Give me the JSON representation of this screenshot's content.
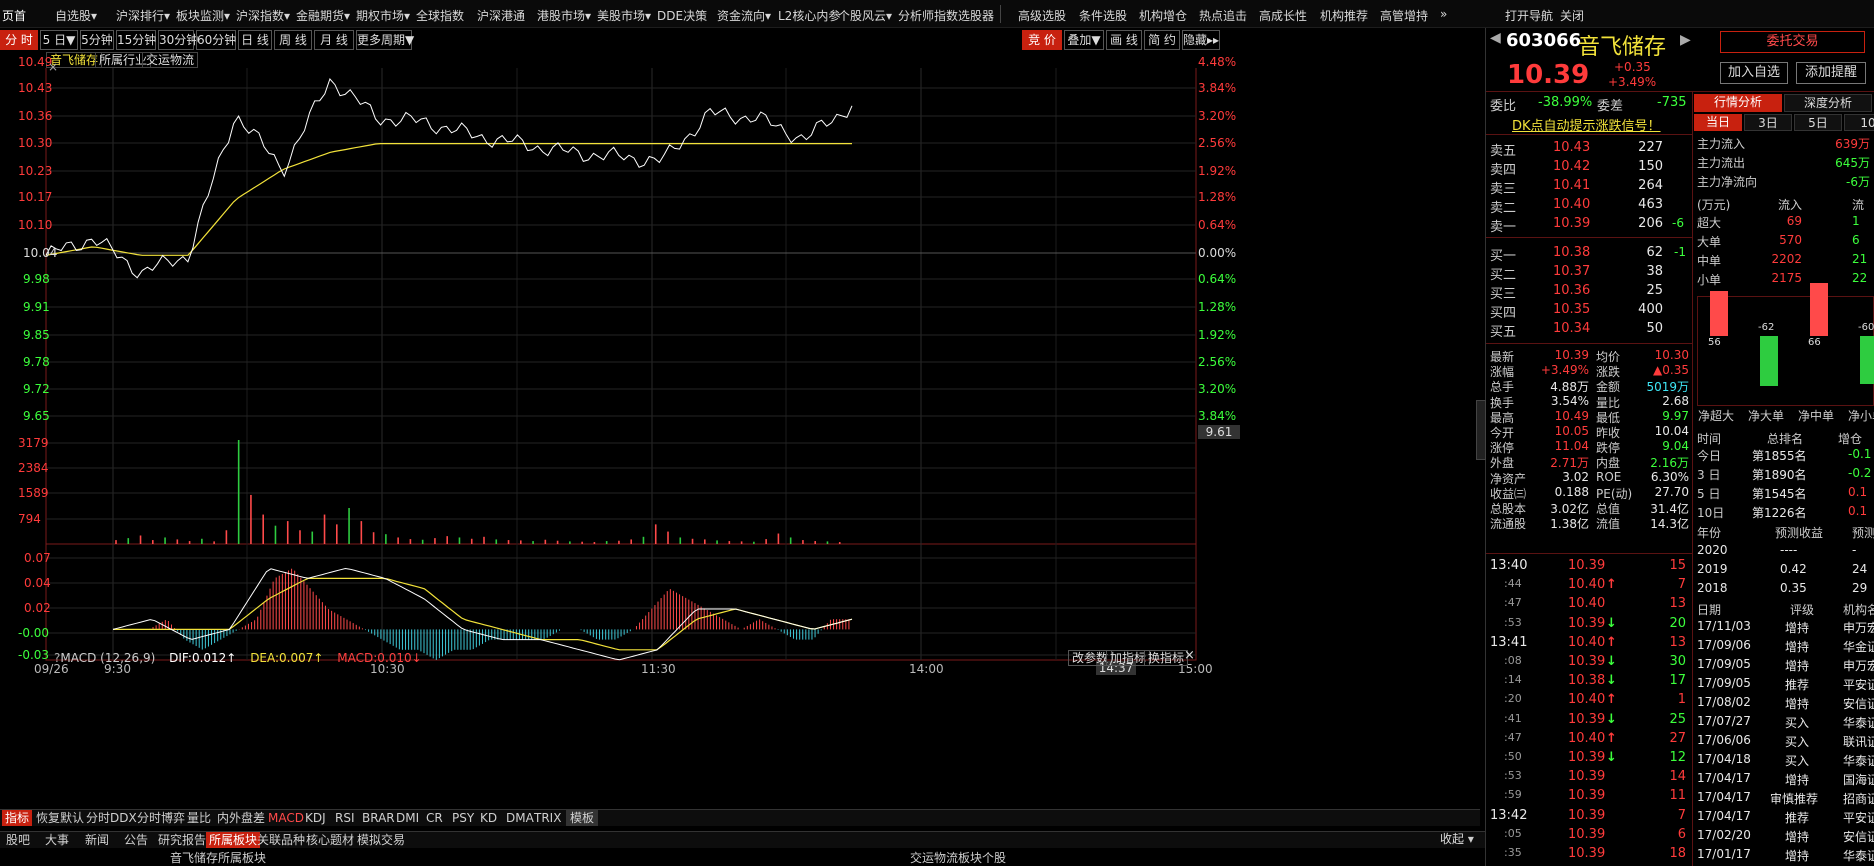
{
  "top_menu": [
    "页首",
    "自选股▾",
    "沪深排行▾",
    "板块监测▾",
    "沪深指数▾",
    "金融期货▾",
    "期权市场▾",
    "全球指数",
    "沪深港通",
    "港股市场▾",
    "美股市场▾",
    "DDE决策",
    "资金流向▾",
    "L2核心内参",
    "个股风云▾",
    "分析师指数",
    "选股器",
    "高级选股",
    "条件选股",
    "机构增仓",
    "热点追击",
    "高成长性",
    "机构推荐",
    "高管增持",
    "»",
    "打开导航",
    "关闭"
  ],
  "period_buttons": [
    "分 时",
    "5 日▼",
    "5分钟",
    "15分钟",
    "30分钟",
    "60分钟",
    "日 线",
    "周 线",
    "月 线",
    "更多周期▼"
  ],
  "chart_tools": [
    "竞 价",
    "叠加▼",
    "画 线",
    "简 约",
    "隐藏▸▸"
  ],
  "sub_tabs": [
    "音飞储存",
    "所属行业",
    "交运物流"
  ],
  "stock": {
    "code": "603066",
    "name": "音飞储存",
    "price": "10.39",
    "change": "+0.35",
    "change_pct": "+3.49%",
    "trade_button": "委托交易",
    "add_watch": "加入自选",
    "add_alert": "添加提醒"
  },
  "price_axis_left": [
    "10.49",
    "10.43",
    "10.36",
    "10.30",
    "10.23",
    "10.17",
    "10.10",
    "10.04",
    "9.98",
    "9.91",
    "9.85",
    "9.78",
    "9.72",
    "9.65"
  ],
  "pct_axis_right": [
    "4.48%",
    "3.84%",
    "3.20%",
    "2.56%",
    "1.92%",
    "1.28%",
    "0.64%",
    "0.00%",
    "0.64%",
    "1.28%",
    "1.92%",
    "2.56%",
    "3.20%",
    "3.84%"
  ],
  "cursor_price": "9.61",
  "volume_axis": [
    "3179",
    "2384",
    "1589",
    "794"
  ],
  "macd": {
    "title": "MACD (12,26,9)",
    "dif": "DIF:0.012↑",
    "dea": "DEA:0.007↑",
    "macd": "MACD:0.010↓",
    "buttons": [
      "改参数",
      "加指标",
      "换指标"
    ],
    "axis": [
      "0.07",
      "0.04",
      "0.02",
      "-0.00",
      "-0.03"
    ]
  },
  "time_axis": [
    "09/26",
    "9:30",
    "10:30",
    "11:30",
    "14:00",
    "15:00"
  ],
  "cursor_time": "14:37",
  "indicator_tabs": [
    "指标",
    "恢复默认",
    "分时DDX",
    "分时博弈",
    "量比",
    "内外盘差",
    "MACD",
    "KDJ",
    "RSI",
    "BRAR",
    "DMI",
    "CR",
    "PSY",
    "KD",
    "DMA",
    "TRIX",
    "模板"
  ],
  "bottom_tabs": [
    "股吧",
    "大事",
    "新闻",
    "公告",
    "研究报告",
    "所属板块",
    "关联品种",
    "核心题材",
    "模拟交易"
  ],
  "bottom_collapse": "收起",
  "bottom_titles": [
    "音飞储存所属板块",
    "交运物流板块个股"
  ],
  "order_summary": {
    "weibi_label": "委比",
    "weibi": "-38.99%",
    "weicha_label": "委差",
    "weicha": "-735"
  },
  "dk_signal": "DK点自动提示涨跌信号！",
  "asks": [
    {
      "label": "卖五",
      "price": "10.43",
      "vol": "227",
      "chg": ""
    },
    {
      "label": "卖四",
      "price": "10.42",
      "vol": "150",
      "chg": ""
    },
    {
      "label": "卖三",
      "price": "10.41",
      "vol": "264",
      "chg": ""
    },
    {
      "label": "卖二",
      "price": "10.40",
      "vol": "463",
      "chg": ""
    },
    {
      "label": "卖一",
      "price": "10.39",
      "vol": "206",
      "chg": "-6"
    }
  ],
  "bids": [
    {
      "label": "买一",
      "price": "10.38",
      "vol": "62",
      "chg": "-1"
    },
    {
      "label": "买二",
      "price": "10.37",
      "vol": "38",
      "chg": ""
    },
    {
      "label": "买三",
      "price": "10.36",
      "vol": "25",
      "chg": ""
    },
    {
      "label": "买四",
      "price": "10.35",
      "vol": "400",
      "chg": ""
    },
    {
      "label": "买五",
      "price": "10.34",
      "vol": "50",
      "chg": ""
    }
  ],
  "quote_rows": [
    [
      "最新",
      "10.39",
      "均价",
      "10.30"
    ],
    [
      "涨幅",
      "+3.49%",
      "涨跌",
      "▲0.35"
    ],
    [
      "总手",
      "4.88万",
      "金额",
      "5019万"
    ],
    [
      "换手",
      "3.54%",
      "量比",
      "2.68"
    ],
    [
      "最高",
      "10.49",
      "最低",
      "9.97"
    ],
    [
      "今开",
      "10.05",
      "昨收",
      "10.04"
    ],
    [
      "涨停",
      "11.04",
      "跌停",
      "9.04"
    ],
    [
      "外盘",
      "2.71万",
      "内盘",
      "2.16万"
    ],
    [
      "净资产",
      "3.02",
      "ROE",
      "6.30%"
    ],
    [
      "收益㈢",
      "0.188",
      "PE(动)",
      "27.70"
    ],
    [
      "总股本",
      "3.02亿",
      "总值",
      "31.4亿"
    ],
    [
      "流通股",
      "1.38亿",
      "流值",
      "14.3亿"
    ]
  ],
  "ticks": [
    [
      "13:40",
      "10.39",
      "",
      "15"
    ],
    [
      ":44",
      "10.40",
      "↑",
      "7"
    ],
    [
      ":47",
      "10.40",
      "",
      "13"
    ],
    [
      ":53",
      "10.39",
      "↓",
      "20"
    ],
    [
      "13:41",
      "10.40",
      "↑",
      "13"
    ],
    [
      ":08",
      "10.39",
      "↓",
      "30"
    ],
    [
      ":14",
      "10.38",
      "↓",
      "17"
    ],
    [
      ":20",
      "10.40",
      "↑",
      "1"
    ],
    [
      ":41",
      "10.39",
      "↓",
      "25"
    ],
    [
      ":47",
      "10.40",
      "↑",
      "27"
    ],
    [
      ":50",
      "10.39",
      "↓",
      "12"
    ],
    [
      ":53",
      "10.39",
      "",
      "14"
    ],
    [
      ":59",
      "10.39",
      "",
      "11"
    ],
    [
      "13:42",
      "10.39",
      "",
      "7"
    ],
    [
      ":05",
      "10.39",
      "",
      "6"
    ],
    [
      ":35",
      "10.39",
      "",
      "18"
    ]
  ],
  "analysis": {
    "tabs": [
      "行情分析",
      "深度分析"
    ],
    "period_tabs": [
      "当日",
      "3日",
      "5日",
      "10"
    ],
    "flows": [
      [
        "主力流入",
        "639万"
      ],
      [
        "主力流出",
        "645万"
      ],
      [
        "主力净流向",
        "-6万"
      ]
    ],
    "table_head": [
      "(万元)",
      "流入",
      "流"
    ],
    "table": [
      [
        "超大",
        "69",
        "1"
      ],
      [
        "大单",
        "570",
        "6"
      ],
      [
        "中单",
        "2202",
        "21"
      ],
      [
        "小单",
        "2175",
        "22"
      ]
    ],
    "net_bars": [
      [
        "净超大",
        "56"
      ],
      [
        "净大单",
        "-62"
      ],
      [
        "净中单",
        "66"
      ],
      [
        "净小单",
        "-60"
      ]
    ],
    "rank_head": [
      "时间",
      "总排名",
      "增仓"
    ],
    "ranks": [
      [
        "今日",
        "第1855名",
        "-0.1"
      ],
      [
        "3 日",
        "第1890名",
        "-0.2"
      ],
      [
        "5 日",
        "第1545名",
        "0.1"
      ],
      [
        "10日",
        "第1226名",
        "0.1"
      ]
    ],
    "forecast_head": [
      "年份",
      "预测收益",
      "预测"
    ],
    "forecast": [
      [
        "2020",
        "----",
        "-"
      ],
      [
        "2019",
        "0.42",
        "24"
      ],
      [
        "2018",
        "0.35",
        "29"
      ]
    ],
    "rating_head": [
      "日期",
      "评级",
      "机构名"
    ],
    "ratings": [
      [
        "17/11/03",
        "增持",
        "申万宏"
      ],
      [
        "17/09/06",
        "增持",
        "华金证"
      ],
      [
        "17/09/05",
        "增持",
        "申万宏"
      ],
      [
        "17/09/05",
        "推荐",
        "平安证"
      ],
      [
        "17/08/02",
        "增持",
        "安信证"
      ],
      [
        "17/07/27",
        "买入",
        "华泰证"
      ],
      [
        "17/06/06",
        "买入",
        "联讯证"
      ],
      [
        "17/04/18",
        "买入",
        "华泰证"
      ],
      [
        "17/04/17",
        "增持",
        "国海证"
      ],
      [
        "17/04/17",
        "审慎推荐",
        "招商证"
      ],
      [
        "17/04/17",
        "推荐",
        "平安证"
      ],
      [
        "17/02/20",
        "增持",
        "安信证"
      ],
      [
        "17/01/17",
        "增持",
        "华泰证"
      ]
    ]
  },
  "chart_data": [
    {
      "type": "line",
      "title": "音飞储存 分时",
      "xlabel": "",
      "ylabel": "",
      "prev_close": 10.04,
      "ylim": [
        9.61,
        10.49
      ],
      "x": [
        "9:30",
        "9:40",
        "9:50",
        "10:00",
        "10:05",
        "10:10",
        "10:20",
        "10:30",
        "10:40",
        "10:50",
        "11:00",
        "11:10",
        "11:20",
        "11:30",
        "13:10",
        "13:20",
        "13:30",
        "13:40"
      ],
      "series": [
        {
          "name": "price",
          "color": "#ffffff",
          "values": [
            10.04,
            10.08,
            10.0,
            10.04,
            10.37,
            10.24,
            10.45,
            10.36,
            10.35,
            10.32,
            10.3,
            10.28,
            10.27,
            10.26,
            10.37,
            10.36,
            10.31,
            10.39
          ]
        },
        {
          "name": "avg",
          "color": "#f2e23a",
          "values": [
            10.04,
            10.06,
            10.04,
            10.04,
            10.17,
            10.24,
            10.28,
            10.3,
            10.3,
            10.3,
            10.3,
            10.3,
            10.3,
            10.3,
            10.3,
            10.3,
            10.3,
            10.3
          ]
        }
      ]
    },
    {
      "type": "bar",
      "title": "成交量",
      "ylim": [
        0,
        3179
      ],
      "values": [
        120,
        180,
        260,
        120,
        200,
        140,
        90,
        160,
        80,
        420,
        3179,
        1500,
        900,
        560,
        700,
        420,
        380,
        900,
        600,
        1100,
        700,
        360,
        300,
        200,
        150,
        130,
        180,
        240,
        200,
        160,
        220,
        140,
        120,
        110,
        90,
        130,
        100,
        80,
        70,
        60,
        90,
        100,
        140,
        220,
        600,
        380,
        200,
        160,
        140,
        110,
        90,
        80,
        70,
        150,
        320,
        200,
        120,
        90,
        80,
        60
      ]
    },
    {
      "type": "bar",
      "title": "MACD (12,26,9)",
      "ylim": [
        -0.03,
        0.07
      ],
      "values": [
        0.0,
        0.0,
        0.0,
        0.01,
        -0.01,
        -0.02,
        -0.01,
        0.0,
        0.01,
        0.05,
        0.06,
        0.04,
        0.02,
        0.01,
        0.0,
        -0.01,
        -0.02,
        -0.02,
        -0.03,
        -0.02,
        -0.02,
        -0.01,
        -0.01,
        -0.01,
        -0.01,
        0.0,
        0.0,
        -0.01,
        -0.01,
        0.0,
        0.02,
        0.04,
        0.03,
        0.02,
        0.01,
        0.0,
        0.01,
        0.0,
        -0.01,
        -0.01,
        0.01,
        0.01
      ]
    }
  ]
}
